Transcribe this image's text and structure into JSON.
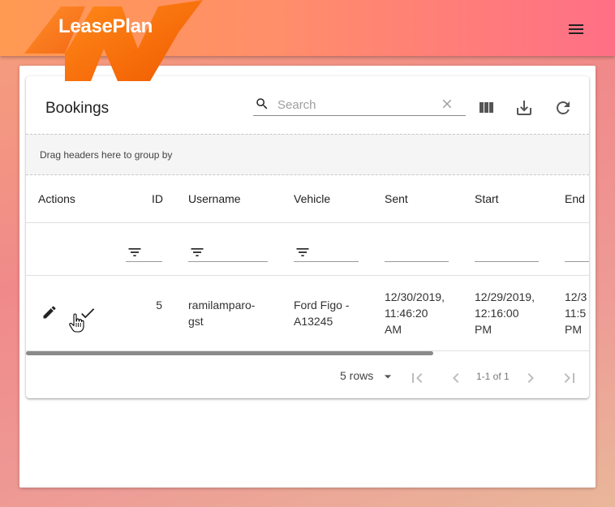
{
  "app": {
    "logo_text": "LeasePlan",
    "menu_icon": "hamburger-menu-icon"
  },
  "grid": {
    "title": "Bookings",
    "search": {
      "placeholder": "Search",
      "value": ""
    },
    "toolbar_icons": [
      "search-icon",
      "clear-icon",
      "columns-icon",
      "download-icon",
      "refresh-icon"
    ],
    "group_hint": "Drag headers here to group by",
    "columns": [
      "Actions",
      "ID",
      "Username",
      "Vehicle",
      "Sent",
      "Start",
      "End"
    ],
    "rows": [
      {
        "id": "5",
        "username_1": "ramilamparo-",
        "username_2": "gst",
        "vehicle_1": "Ford Figo -",
        "vehicle_2": "A13245",
        "sent_1": "12/30/2019,",
        "sent_2": "11:46:20",
        "sent_3": "AM",
        "start_1": "12/29/2019,",
        "start_2": "12:16:00",
        "start_3": "PM",
        "end_1": "12/3",
        "end_2": "11:5",
        "end_3": "PM"
      }
    ],
    "footer": {
      "rows_per_page": "5 rows",
      "page_info": "1-1 of 1"
    }
  },
  "colors": {
    "appbar_start": "#ff9a52",
    "appbar_end": "#ff6f86",
    "logo_orange": "#f26a10"
  }
}
